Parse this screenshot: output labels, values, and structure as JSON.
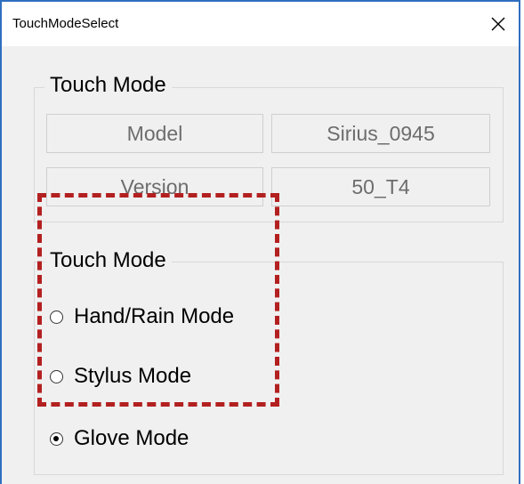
{
  "window": {
    "title": "TouchModeSelect"
  },
  "info_group": {
    "label": "Touch Mode",
    "rows": [
      {
        "key": "Model",
        "value": "Sirius_0945"
      },
      {
        "key": "Version",
        "value": "50_T4"
      }
    ]
  },
  "mode_group": {
    "label": "Touch Mode",
    "options": [
      {
        "label": "Hand/Rain Mode",
        "selected": false
      },
      {
        "label": "Stylus Mode",
        "selected": false
      },
      {
        "label": "Glove Mode",
        "selected": true
      }
    ]
  },
  "annotation": {
    "color": "#b32020"
  }
}
